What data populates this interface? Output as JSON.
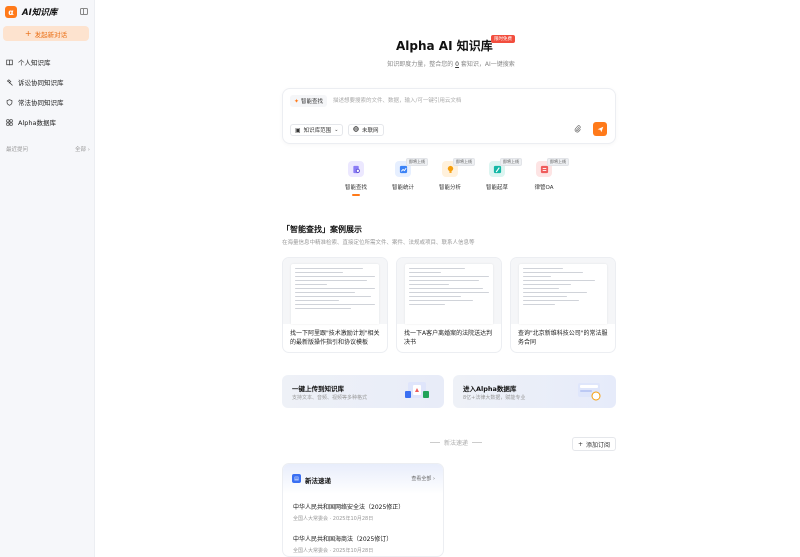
{
  "brand": {
    "name": "AI知识库",
    "logo": "α"
  },
  "sidebar": {
    "new_chat": "发起新对话",
    "items": [
      {
        "label": "个人知识库",
        "icon": "book-icon"
      },
      {
        "label": "诉讼协同知识库",
        "icon": "gavel-icon"
      },
      {
        "label": "常法协同知识库",
        "icon": "shield-icon"
      },
      {
        "label": "Alpha数据库",
        "icon": "database-icon"
      }
    ],
    "recent_label": "最近提问",
    "recent_all": "全部 ›"
  },
  "hero": {
    "title": "Alpha AI 知识库",
    "badge": "限时免费",
    "sub_before": "知识即度力量，整合您的",
    "count": "0",
    "sub_after": "套知识，AI一键搜索"
  },
  "search": {
    "mode_label": "智能查找",
    "placeholder": "描述想要搜索的文件、数据，输入/可一键引用云文档",
    "scope_label": "知识库范围",
    "net_label": "未联网"
  },
  "tools": [
    {
      "label": "智能查找",
      "color": "#8b7cf6",
      "soon": ""
    },
    {
      "label": "智能统计",
      "color": "#3b82f6",
      "soon": "即将上线"
    },
    {
      "label": "智能分析",
      "color": "#f59e0b",
      "soon": "即将上线"
    },
    {
      "label": "智能起草",
      "color": "#14b8a6",
      "soon": "即将上线"
    },
    {
      "label": "律管OA",
      "color": "#ef5b5b",
      "soon": "即将上线"
    }
  ],
  "cases": {
    "title": "「智能查找」案例展示",
    "subtitle": "在海量信息中精准检索、直接定位所需文件、案件、法规或项目、联系人信息等",
    "items": [
      {
        "caption": "找一下阿里跟\"技术激励计划\"相关的最新版操作指引和协议模板"
      },
      {
        "caption": "找一下A客户离婚案的法院送达判决书"
      },
      {
        "caption": "查询\"北京新维科技公司\"的常法服务合同"
      }
    ]
  },
  "features": {
    "upload_title": "一键上传到知识库",
    "upload_sub": "支持文本、音频、视频等多种格式",
    "db_title": "进入Alpha数据库",
    "db_sub": "8亿+法律大数据，赋能专业"
  },
  "laws": {
    "divider": "新法速递",
    "subscribe": "添加订阅",
    "card_title": "新法速递",
    "view_all": "查看全部 ›",
    "items": [
      {
        "name": "中华人民共和国网络安全法（2025修正）",
        "meta": "全国人大常委会 · 2025年10月28日"
      },
      {
        "name": "中华人民共和国海商法（2025修订）",
        "meta": "全国人大常委会 · 2025年10月28日"
      }
    ]
  },
  "colors": {
    "accent": "#ff7a1a",
    "badge": "#f24e3e",
    "blue": "#3a6ff2"
  }
}
